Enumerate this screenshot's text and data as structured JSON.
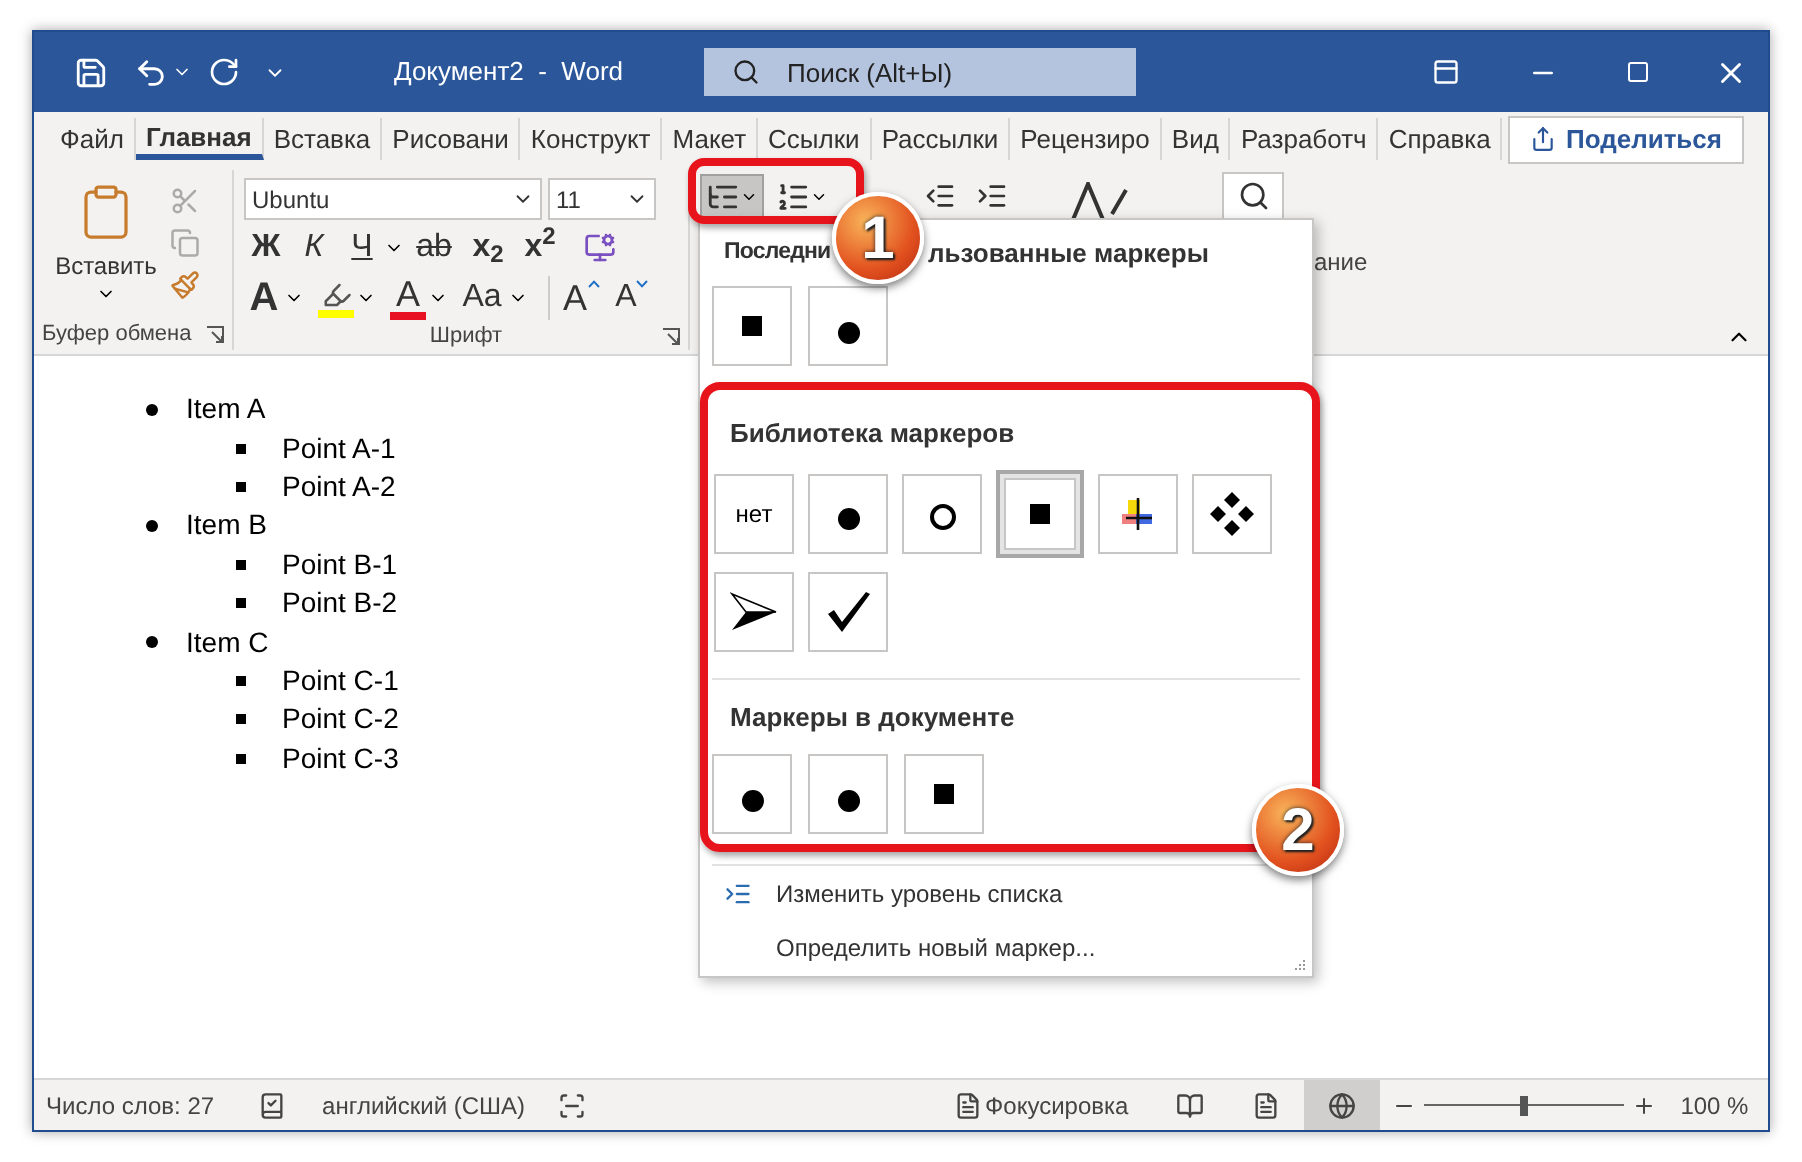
{
  "title_bar": {
    "title": "Документ2  -  Word",
    "search": {
      "placeholder": "Поиск (Alt+Ы)"
    }
  },
  "tabs": [
    {
      "label": "Файл",
      "selected": false
    },
    {
      "label": "Главная",
      "selected": true
    },
    {
      "label": "Вставка",
      "selected": false
    },
    {
      "label": "Рисовани",
      "selected": false
    },
    {
      "label": "Конструкт",
      "selected": false
    },
    {
      "label": "Макет",
      "selected": false
    },
    {
      "label": "Ссылки",
      "selected": false
    },
    {
      "label": "Рассылки",
      "selected": false
    },
    {
      "label": "Рецензиро",
      "selected": false
    },
    {
      "label": "Вид",
      "selected": false
    },
    {
      "label": "Разработч",
      "selected": false
    },
    {
      "label": "Справка",
      "selected": false
    }
  ],
  "share_button": {
    "label": "Поделиться"
  },
  "ribbon": {
    "clipboard": {
      "paste_label": "Вставить",
      "group_label": "Буфер обмена"
    },
    "font": {
      "font_name": "Ubuntu",
      "font_size": "11",
      "group_label": "Шрифт",
      "row_1": [
        {
          "label": "Ж",
          "kind": "bold"
        },
        {
          "label": "К",
          "kind": "italic"
        },
        {
          "label": "Ч",
          "kind": "underline"
        },
        {
          "label": "ab",
          "kind": "strike"
        },
        {
          "label": "x$_{2}$",
          "kind": "plain"
        },
        {
          "label": "x$^{2}$",
          "kind": "plain"
        }
      ],
      "row_2": [
        {
          "label": "A",
          "kind": "effects"
        },
        {
          "kind": "highlight"
        },
        {
          "label": "A",
          "kind": "color"
        },
        {
          "label": "Aa",
          "kind": "case"
        },
        {
          "label": "A",
          "kind": "grow"
        },
        {
          "label": "A",
          "kind": "shrink"
        }
      ]
    },
    "paragraph": {
      "bullets": {
        "selected": true
      },
      "numbering": {
        "selected": false
      }
    },
    "editing_label": "ание"
  },
  "document": {
    "list": [
      {
        "text": "Item A",
        "children": [
          {
            "text": "Point A-1"
          },
          {
            "text": "Point A-2"
          }
        ]
      },
      {
        "text": "Item B",
        "children": [
          {
            "text": "Point B-1"
          },
          {
            "text": "Point B-2"
          }
        ]
      },
      {
        "text": "Item C",
        "children": [
          {
            "text": "Point C-1"
          },
          {
            "text": "Point C-2"
          },
          {
            "text": "Point C-3"
          }
        ]
      }
    ]
  },
  "bullet_menu": {
    "recent": {
      "title_parts": [
        "Последни",
        "льзованные маркеры"
      ],
      "markers": [
        {
          "kind": "square",
          "selected": false
        },
        {
          "kind": "dot",
          "selected": false
        }
      ]
    },
    "library": {
      "title": "Библиотека маркеров",
      "markers": [
        {
          "kind": "none",
          "label": "нет",
          "selected": false
        },
        {
          "kind": "dot",
          "selected": false
        },
        {
          "kind": "circle",
          "selected": false
        },
        {
          "kind": "square",
          "selected": true
        },
        {
          "kind": "cross",
          "selected": false
        },
        {
          "kind": "diamonds",
          "selected": false
        },
        {
          "kind": "arrowhead",
          "selected": false
        },
        {
          "kind": "check",
          "selected": false
        }
      ]
    },
    "in_document": {
      "title": "Маркеры в документе",
      "markers": [
        {
          "kind": "dot",
          "selected": false
        },
        {
          "kind": "dot",
          "selected": false
        },
        {
          "kind": "square",
          "selected": false
        }
      ]
    },
    "actions": [
      {
        "label": "Изменить уровень списка",
        "kind": "level"
      },
      {
        "label": "Определить новый маркер...",
        "kind": "define"
      }
    ]
  },
  "callouts": [
    "1",
    "2"
  ],
  "status_bar": {
    "word_count": "Число слов: 27",
    "language": "английский (США)",
    "focus": "Фокусировка",
    "views": [
      {
        "kind": "read",
        "selected": false
      },
      {
        "kind": "print",
        "selected": false
      },
      {
        "kind": "web",
        "selected": true
      }
    ],
    "zoom": {
      "level": 0.5,
      "reading": "100 %"
    }
  }
}
